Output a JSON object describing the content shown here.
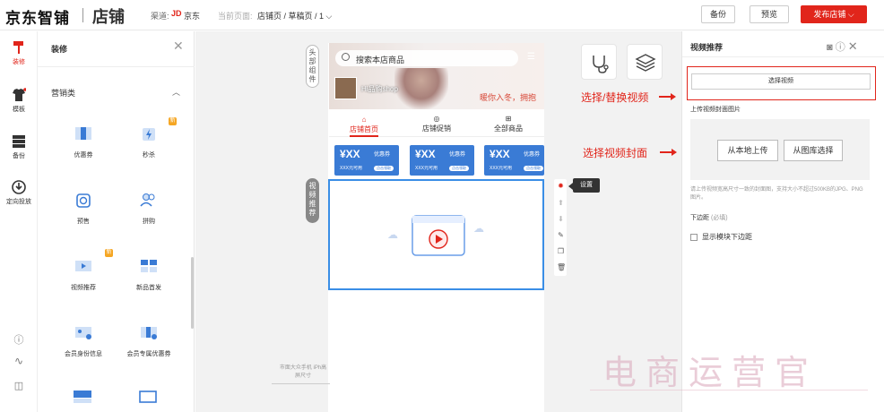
{
  "header": {
    "brand": "京东智铺",
    "section": "店铺",
    "channel_label": "渠道:",
    "channel_logo": "JD",
    "channel_name": "京东",
    "current_label": "当前页面:",
    "current_value": "店铺页 / 草稿页 / 1 ⌵",
    "backup": "备份",
    "preview": "预览",
    "publish": "发布店铺 ⌵"
  },
  "rail": [
    {
      "label": "装修",
      "icon": "paint-roller-icon",
      "active": true
    },
    {
      "label": "模板",
      "icon": "tshirt-icon"
    },
    {
      "label": "备份",
      "icon": "server-icon"
    },
    {
      "label": "定向投放",
      "icon": "target-icon"
    }
  ],
  "panel": {
    "title": "装修",
    "category": "营销类",
    "items": [
      {
        "label": "优惠券",
        "icon": "coupon-icon"
      },
      {
        "label": "秒杀",
        "icon": "flash-sale-icon"
      },
      {
        "label": "预售",
        "icon": "presale-icon"
      },
      {
        "label": "拼购",
        "icon": "group-buy-icon"
      },
      {
        "label": "视频推荐",
        "icon": "video-icon"
      },
      {
        "label": "新品首发",
        "icon": "new-product-icon"
      },
      {
        "label": "会员身份信息",
        "icon": "member-card-icon"
      },
      {
        "label": "会员专属优惠券",
        "icon": "member-coupon-icon"
      }
    ],
    "new_badge": "新"
  },
  "canvas": {
    "top_area_label": "头部组件",
    "video_label": "视频推荐",
    "search_placeholder": "搜索本店商品",
    "shop_name": "Hi品购shop",
    "banner_text": "暖你入冬，拥抱",
    "tabs": [
      {
        "label": "店铺首页",
        "icon": "⌂"
      },
      {
        "label": "店铺促销",
        "icon": "◎"
      },
      {
        "label": "全部商品",
        "icon": "⊞"
      }
    ],
    "coupons": [
      {
        "value": "¥XX",
        "tag": "优惠券",
        "sub": "XXX元可用",
        "btn": "点击领取"
      },
      {
        "value": "¥XX",
        "tag": "优惠券",
        "sub": "XXX元可用",
        "btn": "点击领取"
      },
      {
        "value": "¥XX",
        "tag": "优惠券",
        "sub": "XXX元可用",
        "btn": "点击领取"
      }
    ],
    "tooltip": "设置",
    "phone_footer": "市面大众手机 iPh高屏尺寸",
    "annotations": {
      "select_video": "选择/替换视频",
      "select_cover": "选择视频封面"
    }
  },
  "settings": {
    "title": "视频推荐",
    "select_video_btn": "选择视频",
    "cover_label": "上传视频封面图片",
    "upload_local": "从本地上传",
    "upload_lib": "从图库选择",
    "cover_hint": "请上传视频宽高尺寸一致的封面图，支持大小不超过500KB的JPG、PNG图片。",
    "margin_label": "下边距",
    "margin_unit": "(必填)",
    "show_margin": "显示模块下边距"
  },
  "watermark": "电商运营官",
  "colors": {
    "accent": "#e1251b",
    "selection": "#3a8ee6",
    "coupon": "#3a7bd5"
  }
}
